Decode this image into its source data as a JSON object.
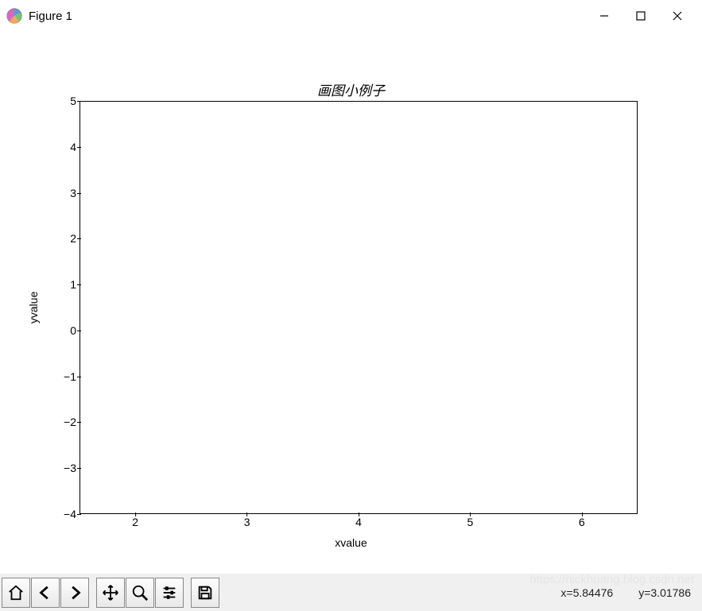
{
  "window": {
    "title": "Figure 1"
  },
  "chart_data": {
    "type": "line",
    "title": "画图小例子",
    "xlabel": "xvalue",
    "ylabel": "yvalue",
    "xlim": [
      1.5,
      6.5
    ],
    "ylim": [
      -4,
      5
    ],
    "xticks": [
      2,
      3,
      4,
      5,
      6
    ],
    "yticks": [
      -4,
      -3,
      -2,
      -1,
      0,
      1,
      2,
      3,
      4,
      5
    ],
    "series": []
  },
  "toolbar": {
    "home": "Home",
    "back": "Back",
    "forward": "Forward",
    "pan": "Pan",
    "zoom": "Zoom",
    "configure": "Configure subplots",
    "save": "Save"
  },
  "status": {
    "x_label": "x=",
    "x_value": "5.84476",
    "y_label": "y=",
    "y_value": "3.01786"
  },
  "watermark": "https://nickhuang.blog.csdn.net"
}
